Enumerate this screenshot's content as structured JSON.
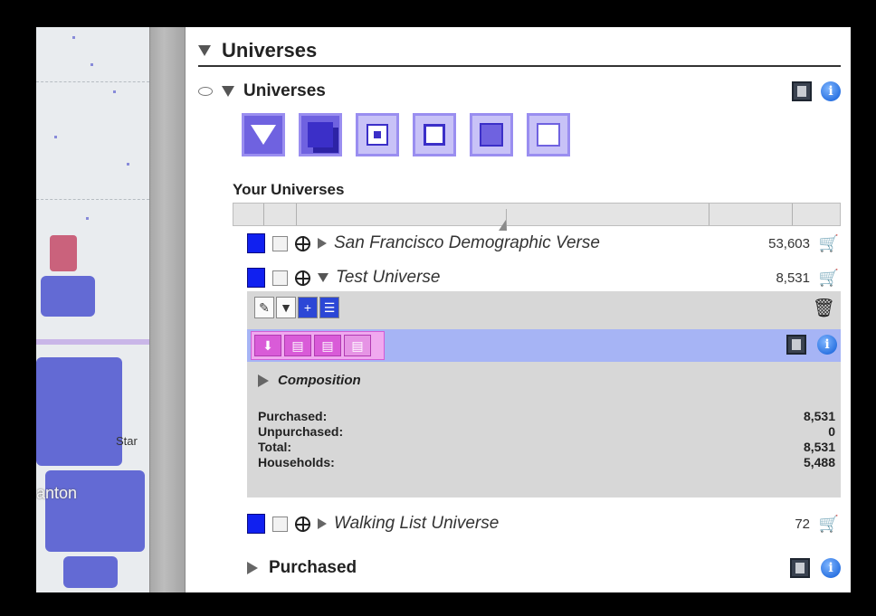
{
  "map": {
    "labels": [
      "Star",
      "anton"
    ]
  },
  "panel": {
    "title": "Universes",
    "sub_title": "Universes",
    "filter_buttons": [
      "filter-icon",
      "union-icon",
      "intersect-icon",
      "subtract-icon",
      "expand-icon",
      "shrink-icon"
    ],
    "your_label": "Your Universes",
    "universes": [
      {
        "name": "San Francisco Demographic Verse",
        "count": "53,603"
      },
      {
        "name": "Test Universe",
        "count": "8,531"
      },
      {
        "name": "Walking List Universe",
        "count": "72"
      }
    ],
    "composition_label": "Composition",
    "stats": [
      {
        "label": "Purchased:",
        "value": "8,531"
      },
      {
        "label": "Unpurchased:",
        "value": "0"
      },
      {
        "label": "Total:",
        "value": "8,531"
      },
      {
        "label": "Households:",
        "value": "5,488"
      }
    ],
    "purchased_label": "Purchased"
  },
  "colors": {
    "accent": "#1020f0",
    "action_bar": "#a6b4f5",
    "pink": "#d95bd8"
  }
}
